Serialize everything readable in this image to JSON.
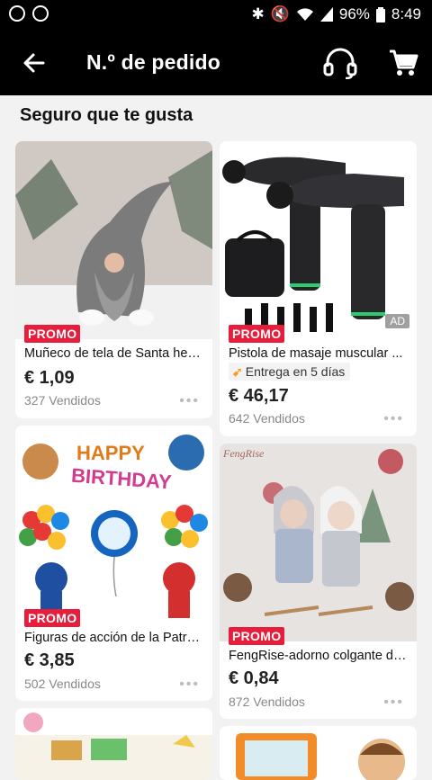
{
  "status_bar": {
    "battery": "96%",
    "time": "8:49"
  },
  "header": {
    "title": "N.º de pedido"
  },
  "section": {
    "title": "Seguro que te gusta"
  },
  "products": [
    {
      "badge": "PROMO",
      "name": "Muñeco de tela de Santa hec...",
      "price": "€ 1,09",
      "sold": "327 Vendidos",
      "more": "•••"
    },
    {
      "badge": "PROMO",
      "name": "Pistola de masaje muscular ...",
      "delivery": "Entrega en 5 días",
      "price": "€ 46,17",
      "sold": "642 Vendidos",
      "ad": "AD",
      "more": "•••"
    },
    {
      "badge": "PROMO",
      "name": "Figuras de acción de la Patrul...",
      "price": "€ 3,85",
      "sold": "502 Vendidos",
      "more": "•••",
      "image_text": [
        "HAPPY",
        "BIRTHDAY"
      ]
    },
    {
      "badge": "PROMO",
      "name": "FengRise-adorno colgante de...",
      "price": "€ 0,84",
      "sold": "872 Vendidos",
      "more": "•••",
      "brand": "FengRise"
    }
  ],
  "colors": {
    "promo": "#e61e3c",
    "header_bg": "#000000",
    "page_bg": "#f2f2f2"
  }
}
